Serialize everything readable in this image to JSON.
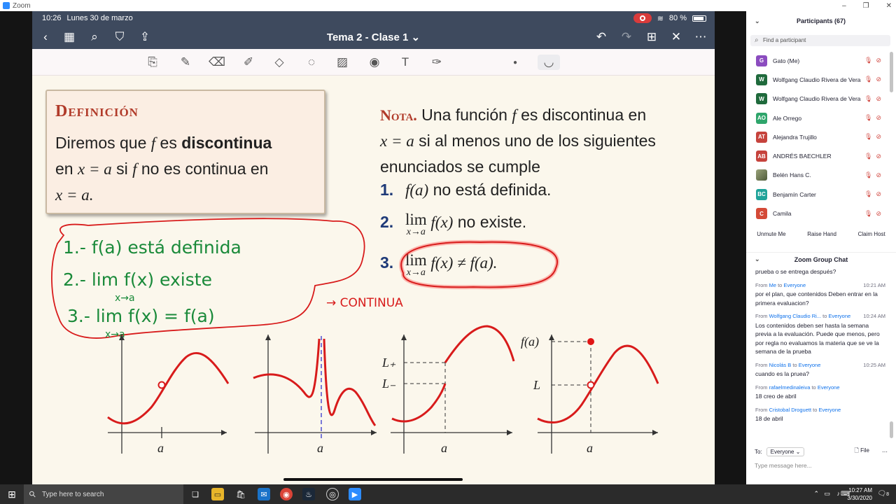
{
  "window": {
    "app_title": "Zoom",
    "minimize": "–",
    "restore": "❐",
    "close": "✕"
  },
  "ipad": {
    "time": "10:26",
    "date": "Lunes 30 de marzo",
    "battery": "80 %",
    "doc_title": "Tema 2 - Clase 1",
    "doc_chevron": "⌄"
  },
  "definition": {
    "title": "Definición",
    "line1_pre": "Diremos que ",
    "line1_f": "f",
    "line1_mid": " es ",
    "line1_bold": "discontinua",
    "line2_pre": "en ",
    "line2_math": "x = a",
    "line2_mid": " si ",
    "line2_f": "f",
    "line2_post": " no es continua en",
    "line3_math": "x = a."
  },
  "note": {
    "heading": "Nota.",
    "l1_pre": " Una función ",
    "l1_f": "f",
    "l1_post": " es discontinua en",
    "l2_math": "x = a",
    "l2_post": " si al menos uno de los siguientes",
    "l3": "enunciados se cumple",
    "item1_num": "1.",
    "item1_math": "f(a)",
    "item1_text": " no está definida.",
    "item2_num": "2.",
    "item2_lim": "lim",
    "item2_sub": "x→a",
    "item2_math": " f(x)",
    "item2_text": " no existe.",
    "item3_num": "3.",
    "item3_lim": "lim",
    "item3_sub": "x→a",
    "item3_math": " f(x) ≠ f(a)."
  },
  "handwriting": {
    "line1": "1.- f(a) está definida",
    "line2": "2.- lim f(x) existe",
    "line2_sub": "x→a",
    "line3": "3.- lim f(x) = f(a)",
    "line3_sub": "x→a",
    "arrow_label": "→ CONTINUA"
  },
  "graph_labels": {
    "a": "a",
    "L_plus": "L₊",
    "L_minus": "L₋",
    "fa": "f(a)",
    "L": "L"
  },
  "zoom": {
    "participants_title": "Participants (67)",
    "find_placeholder": "Find a participant",
    "participants": [
      {
        "initials": "G",
        "name": "Gato (Me)",
        "color": "#8b4cbf"
      },
      {
        "initials": "W",
        "name": "Wolfgang Claudio Rivera de Vera",
        "color": "#1f6a3c"
      },
      {
        "initials": "W",
        "name": "Wolfgang Claudio Rivera de Vera",
        "color": "#1f6a3c"
      },
      {
        "initials": "AO",
        "name": "Ale Orrego",
        "color": "#2ea56b"
      },
      {
        "initials": "AT",
        "name": "Alejandra Trujillo",
        "color": "#c6433d"
      },
      {
        "initials": "AB",
        "name": "ANDRÉS BAECHLER",
        "color": "#c6433d"
      },
      {
        "initials": "",
        "name": "Belén Hans C.",
        "color": "#6d7b5a"
      },
      {
        "initials": "BC",
        "name": "Benjamín Carter",
        "color": "#1fa39a"
      },
      {
        "initials": "C",
        "name": "Camila",
        "color": "#d44a37"
      }
    ],
    "buttons": {
      "unmute": "Unmute Me",
      "raise": "Raise Hand",
      "claim": "Claim Host"
    },
    "chat_title": "Zoom Group Chat",
    "chat_first": "prueba o se entrega después?",
    "messages": [
      {
        "from": "Me",
        "to": "Everyone",
        "time": "10:21 AM",
        "text": "por el plan, que contenidos Deben entrar en la primera evaluacion?"
      },
      {
        "from": "Wolfgang Claudio Ri...",
        "to": "Everyone",
        "time": "10:24 AM",
        "text": "Los contenidos deben ser hasta la semana previa a la evaluación. Puede que menos, pero por regla no evaluamos la materia que se ve la semana de la prueba"
      },
      {
        "from": "Nicolás B",
        "to": "Everyone",
        "time": "10:25 AM",
        "text": "cuando es la pruea?"
      },
      {
        "from": "rafaelmedinaleiva",
        "to": "Everyone",
        "time": "",
        "text": "18 creo de abril"
      },
      {
        "from": "Cristobal Droguett",
        "to": "Everyone",
        "time": "",
        "text": "18 de abril"
      }
    ],
    "to_label": "To:",
    "to_value": "Everyone",
    "file_label": "File",
    "message_placeholder": "Type message here..."
  },
  "taskbar": {
    "search_placeholder": "Type here to search",
    "time": "10:27 AM",
    "date": "3/30/2020",
    "notifications": "8"
  }
}
